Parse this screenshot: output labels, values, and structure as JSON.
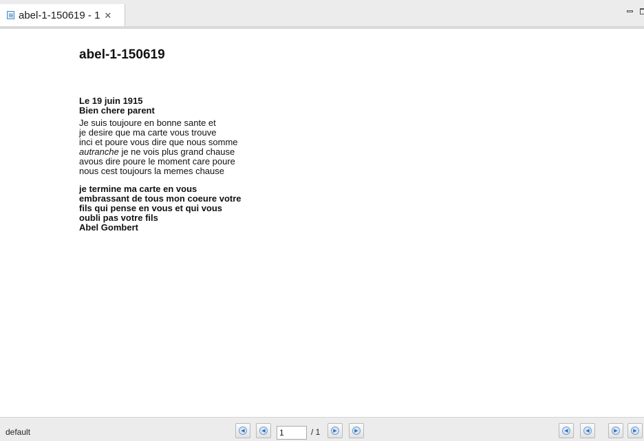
{
  "tab": {
    "title": "abel-1-150619 - 1",
    "close_glyph": "✕"
  },
  "document": {
    "title": "abel-1-150619",
    "paragraph1": [
      "Le 19 juin 1915",
      "Bien chere parent"
    ],
    "paragraph2": [
      "Je suis toujoure en bonne sante et",
      "je desire que ma carte vous trouve",
      "inci et poure vous dire que nous somme",
      {
        "italic": "autranche",
        "rest": " je ne vois plus grand chause"
      },
      "avous dire poure le moment care poure",
      "nous cest toujours la memes chause"
    ],
    "paragraph3": [
      "je termine ma carte en vous",
      "embrassant de tous mon coeure votre",
      "fils qui pense en vous et qui vous",
      "oubli pas votre fils",
      "Abel Gombert"
    ]
  },
  "statusbar": {
    "label": "default",
    "page_value": "1",
    "page_total": "/ 1",
    "nav_icons": [
      "first-page-icon",
      "prev-page-icon",
      "next-page-icon",
      "last-page-icon",
      "rewind-icon",
      "back-icon",
      "forward-icon",
      "fast-forward-icon"
    ]
  }
}
